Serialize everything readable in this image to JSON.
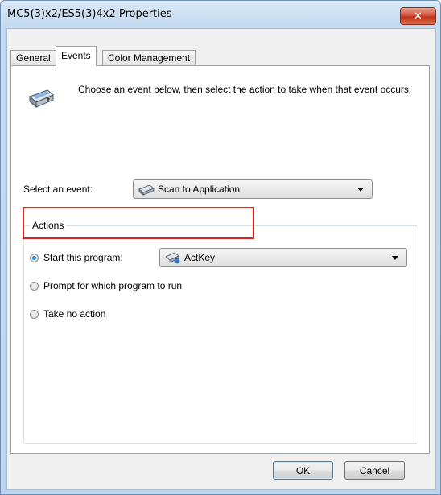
{
  "window": {
    "title": "MC5(3)x2/ES5(3)4x2 Properties",
    "close_label": "✕"
  },
  "tabs": [
    {
      "label": "General",
      "active": false
    },
    {
      "label": "Events",
      "active": true
    },
    {
      "label": "Color Management",
      "active": false
    }
  ],
  "intro": {
    "icon": "scanner-icon",
    "text": "Choose an event below, then select the action to take when that event occurs."
  },
  "event": {
    "label": "Select an event:",
    "selected": "Scan to Application",
    "icon": "scanner-icon"
  },
  "actions": {
    "group_title": "Actions",
    "options": [
      {
        "label": "Start this program:",
        "checked": true
      },
      {
        "label": "Prompt for which program to run",
        "checked": false
      },
      {
        "label": "Take no action",
        "checked": false
      }
    ],
    "program": {
      "selected": "ActKey",
      "icon": "program-icon"
    }
  },
  "buttons": {
    "ok": "OK",
    "cancel": "Cancel"
  },
  "colors": {
    "highlight": "#e02020",
    "close_button": "#c2341c",
    "titlebar": "#c4daf0"
  }
}
